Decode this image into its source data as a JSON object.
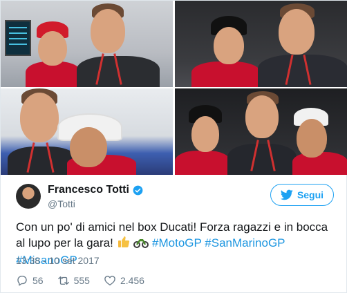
{
  "author": {
    "name": "Francesco Totti",
    "handle": "@Totti"
  },
  "follow_label": "Segui",
  "tweet": {
    "text_start": "Con un po' di amici nel box Ducati! Forza ragazzi e in bocca al lupo per la gara!",
    "emoji": [
      "thumbs-up-icon",
      "motorcycle-icon"
    ],
    "hashtags": [
      "#MotoGP",
      "#SanMarinoGP",
      "#MisanoGP"
    ]
  },
  "timestamp": "13:38 - 10 set 2017",
  "stats": {
    "replies": "56",
    "retweets": "555",
    "likes": "2.456"
  },
  "colors": {
    "accent": "#1da1f2",
    "hashtag": "#1b95e0",
    "muted": "#657786"
  }
}
